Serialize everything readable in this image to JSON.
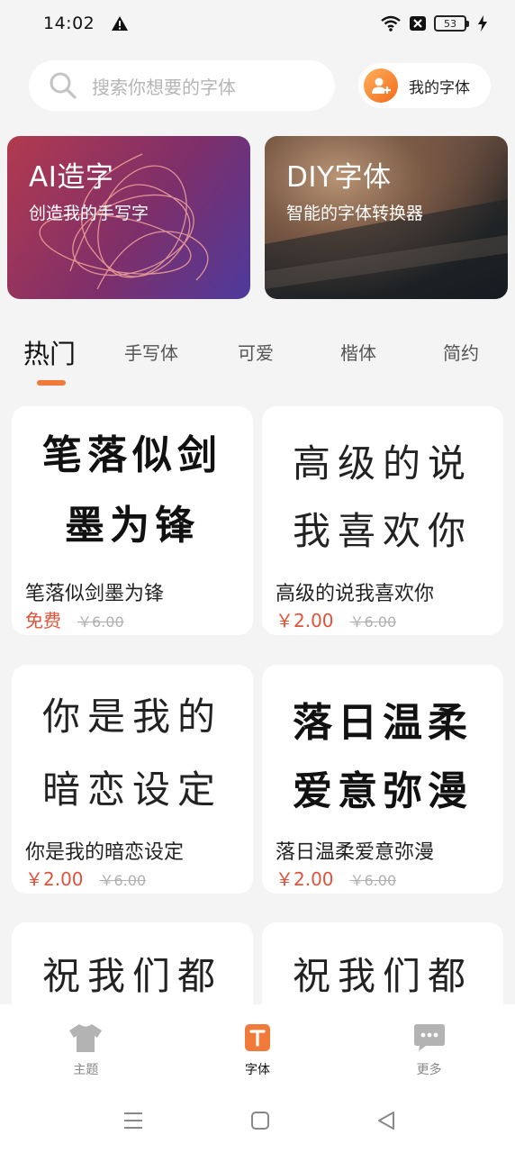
{
  "status_bar": {
    "time": "14:02",
    "battery": "53"
  },
  "search": {
    "placeholder": "搜索你想要的字体"
  },
  "my_fonts": {
    "label": "我的字体"
  },
  "banners": [
    {
      "title": "AI造字",
      "subtitle": "创造我的手写字"
    },
    {
      "title": "DIY字体",
      "subtitle": "智能的字体转换器"
    }
  ],
  "tabs": [
    {
      "label": "热门",
      "active": true
    },
    {
      "label": "手写体"
    },
    {
      "label": "可爱"
    },
    {
      "label": "楷体"
    },
    {
      "label": "简约"
    }
  ],
  "cards": [
    {
      "preview": [
        "笔落似剑",
        "墨为锋"
      ],
      "name": "笔落似剑墨为锋",
      "price": "免费",
      "old_price": "￥6.00"
    },
    {
      "preview": [
        "高级的说",
        "我喜欢你"
      ],
      "name": "高级的说我喜欢你",
      "price": "￥2.00",
      "old_price": "￥6.00"
    },
    {
      "preview": [
        "你是我的",
        "暗恋设定"
      ],
      "name": "你是我的暗恋设定",
      "price": "￥2.00",
      "old_price": "￥6.00"
    },
    {
      "preview": [
        "落日温柔",
        "爱意弥漫"
      ],
      "name": "落日温柔爱意弥漫",
      "price": "￥2.00",
      "old_price": "￥6.00"
    },
    {
      "preview": [
        "祝我们都"
      ]
    },
    {
      "preview": [
        "祝我们都"
      ]
    }
  ],
  "bottom_nav": [
    {
      "label": "主题",
      "icon": "tshirt-icon"
    },
    {
      "label": "字体",
      "icon": "font-t-icon",
      "active": true
    },
    {
      "label": "更多",
      "icon": "chat-bubble-icon"
    }
  ],
  "colors": {
    "accent": "#f07a3a",
    "price": "#e0533a",
    "background": "#f4f4f4"
  }
}
